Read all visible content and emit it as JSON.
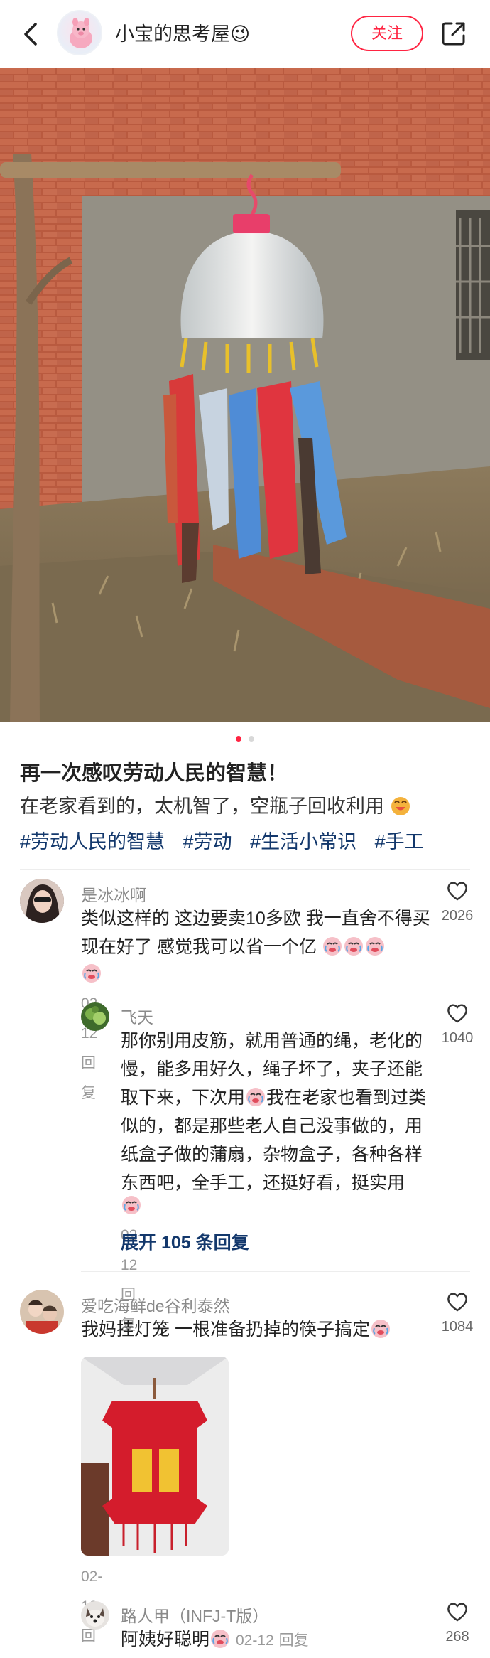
{
  "header": {
    "author_name": "小宝的思考屋😉",
    "follow_label": "关注"
  },
  "post": {
    "title": "再一次感叹劳动人民的智慧！",
    "description": "在老家看到的，太机智了，空瓶子回收利用",
    "tags": [
      "#劳动人民的智慧",
      "#劳动",
      "#生活小常识",
      "#手工"
    ],
    "image_count": 2,
    "current_image": 1
  },
  "comments": [
    {
      "user": "是冰冰啊",
      "text": "类似这样的 这边要卖10多欧  我一直舍不得买  现在好了 感觉我可以省一个亿",
      "date": "02-12",
      "reply_label": "回复",
      "likes": "2026",
      "replies": [
        {
          "user": "飞天",
          "text_1": "那你别用皮筋，就用普通的绳，老化的慢，能多用好久，绳子坏了，夹子还能取下来，下次用",
          "text_2": "我在老家也看到过类似的，都是那些老人自己没事做的，用纸盒子做的蒲扇，杂物盒子，各种各样东西吧，全手工，还挺好看，挺实用",
          "date": "02-12",
          "reply_label": "回复",
          "likes": "1040"
        }
      ],
      "expand_label": "展开 105 条回复"
    },
    {
      "user": "爱吃海鲜de谷利泰然",
      "text": "我妈挂灯笼 一根准备扔掉的筷子搞定",
      "date": "02-12",
      "reply_label": "回复",
      "likes": "1084",
      "replies": [
        {
          "user": "路人甲（INFJ-T版）",
          "text": "阿姨好聪明",
          "date": "02-12",
          "reply_label": "回复",
          "likes": "268"
        }
      ]
    }
  ],
  "colors": {
    "accent": "#ff2442",
    "tag": "#13386c",
    "secondary_text": "#8a8a8a"
  }
}
